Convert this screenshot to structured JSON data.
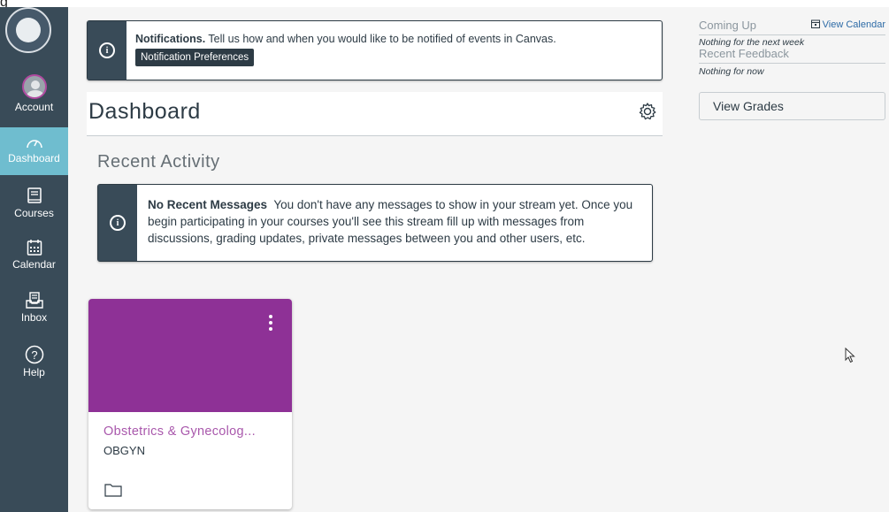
{
  "top_strip": {
    "glyph": "g"
  },
  "sidebar": {
    "items": [
      {
        "label": "Account",
        "icon": "avatar-icon"
      },
      {
        "label": "Dashboard",
        "icon": "speedometer-icon",
        "active": true
      },
      {
        "label": "Courses",
        "icon": "book-icon"
      },
      {
        "label": "Calendar",
        "icon": "calendar-icon"
      },
      {
        "label": "Inbox",
        "icon": "inbox-icon"
      },
      {
        "label": "Help",
        "icon": "help-icon"
      }
    ]
  },
  "notification": {
    "title": "Notifications.",
    "text": "Tell us how and when you would like to be notified of events in Canvas.",
    "button": "Notification Preferences"
  },
  "dashboard": {
    "title": "Dashboard"
  },
  "recent": {
    "title": "Recent Activity",
    "alert_title": "No Recent Messages",
    "alert_text": "You don't have any messages to show in your stream yet. Once you begin participating in your courses you'll see this stream fill up with messages from discussions, grading updates, private messages between you and other users, etc."
  },
  "course_card": {
    "name": "Obstetrics & Gynecolog...",
    "code": "OBGYN",
    "color": "#8e3196"
  },
  "right_panel": {
    "coming_up": "Coming Up",
    "view_calendar": "View Calendar",
    "coming_up_empty": "Nothing for the next week",
    "recent_feedback": "Recent Feedback",
    "feedback_empty": "Nothing for now",
    "view_grades": "View Grades"
  },
  "colors": {
    "sidebar": "#394b58",
    "active": "#6fbdcf",
    "card": "#8e3196"
  }
}
